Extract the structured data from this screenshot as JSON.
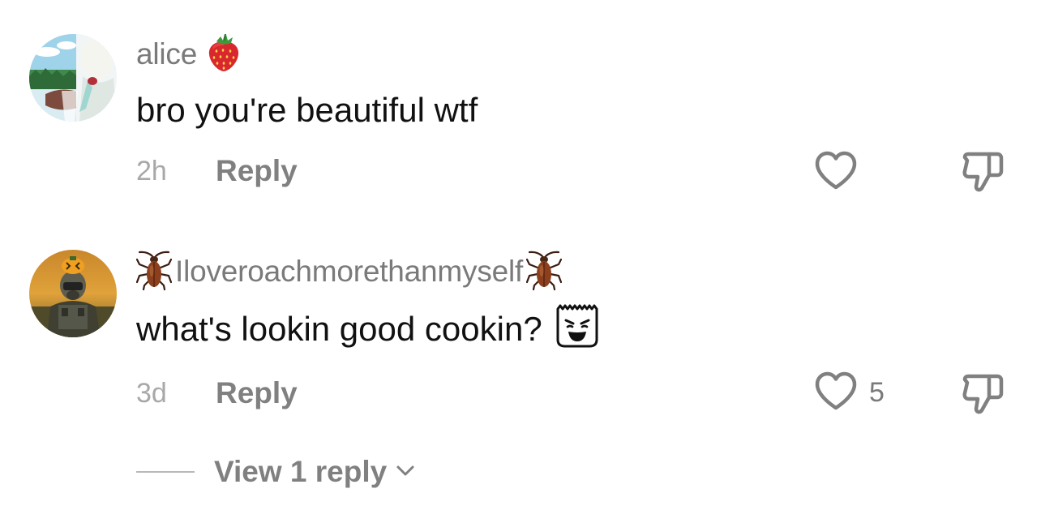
{
  "comments": [
    {
      "username": "alice",
      "username_badge_icon": "strawberry-icon",
      "text": "bro you're beautiful wtf",
      "time": "2h",
      "reply_label": "Reply",
      "like_count": ""
    },
    {
      "username": "Iloveroachmorethanmyself",
      "username_badge_icon": "cockroach-icon",
      "text": "what's lookin good cookin?",
      "text_sticker_icon": "smirking-bag-face-icon",
      "time": "3d",
      "reply_label": "Reply",
      "like_count": "5"
    }
  ],
  "view_replies_label": "View 1 reply",
  "colors": {
    "text": "#111111",
    "muted": "#808080",
    "timestamp": "#a8a8a8",
    "background": "#ffffff"
  }
}
